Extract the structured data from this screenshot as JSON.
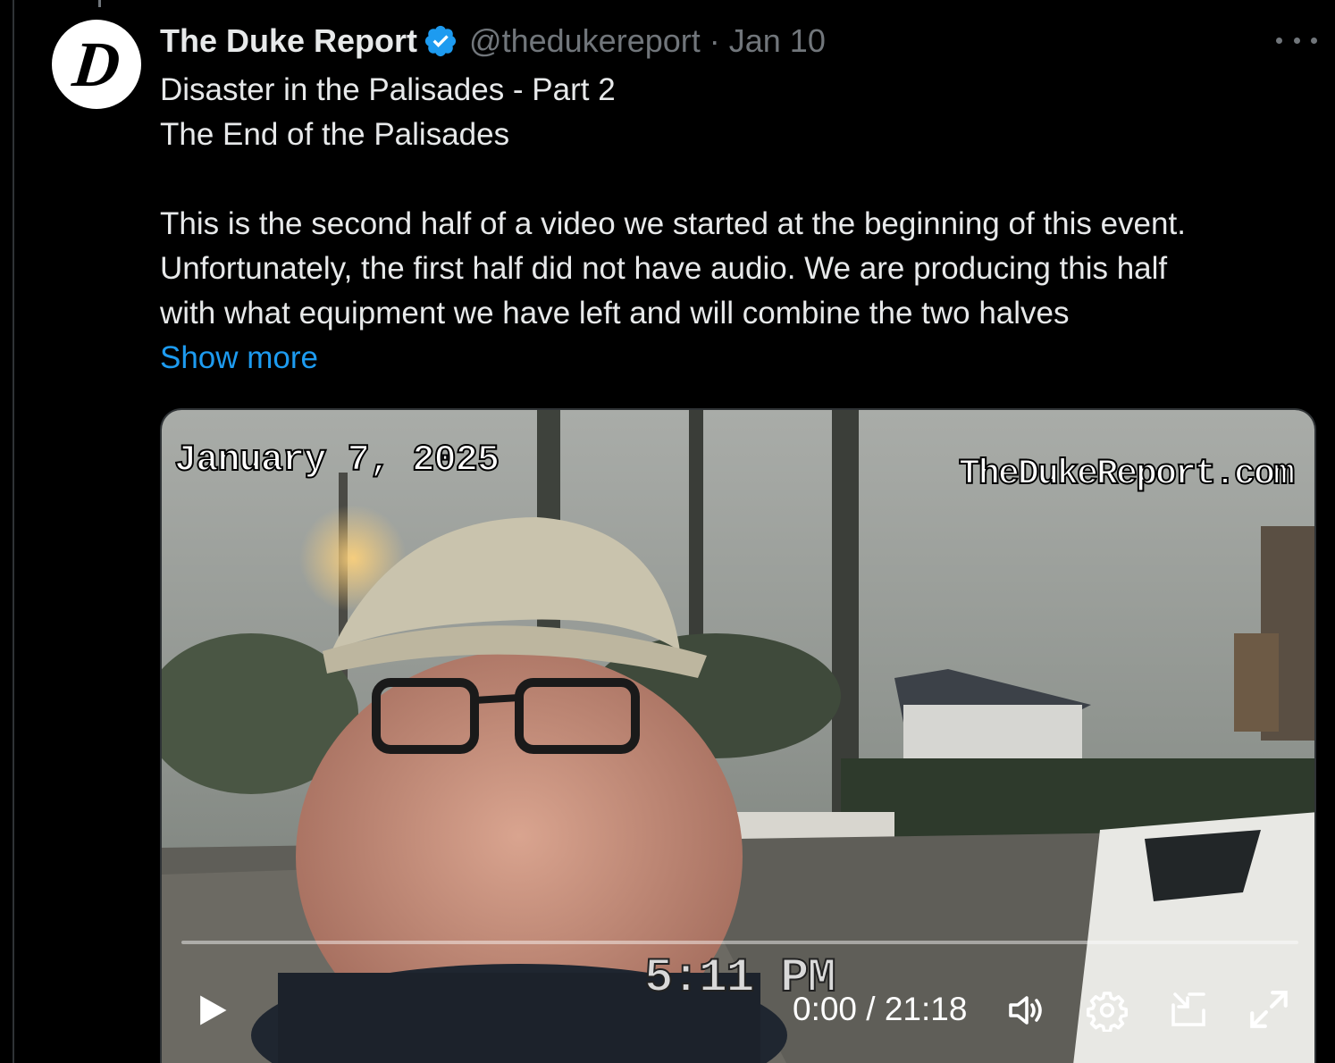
{
  "tweet": {
    "author": {
      "display_name": "The Duke Report",
      "handle": "@thedukereport",
      "avatar_letter": "D",
      "verified": true
    },
    "separator": "·",
    "date": "Jan 10",
    "text_lines": [
      "Disaster in the Palisades - Part 2",
      "The End of the Palisades",
      "",
      "This is the second half of a video we started at the beginning of this event.",
      "Unfortunately, the first half did not have audio. We are producing this half",
      "with what equipment we have left and will combine the two halves"
    ],
    "show_more_label": "Show more",
    "more_icon": "more-horizontal-icon"
  },
  "video": {
    "overlay_date": "January 7, 2025",
    "overlay_site": "TheDukeReport.com",
    "overlay_time": "5:11 PM",
    "current_time": "0:00",
    "time_separator": "/",
    "duration": "21:18",
    "progress_fraction": 0,
    "icons": {
      "play": "play-icon",
      "volume": "volume-icon",
      "settings": "settings-gear-icon",
      "pip": "picture-in-picture-icon",
      "fullscreen": "fullscreen-icon"
    }
  },
  "colors": {
    "background": "#000000",
    "text": "#e7e9ea",
    "secondary_text": "#71767b",
    "link": "#1d9bf0",
    "verified_badge": "#1d9bf0"
  }
}
